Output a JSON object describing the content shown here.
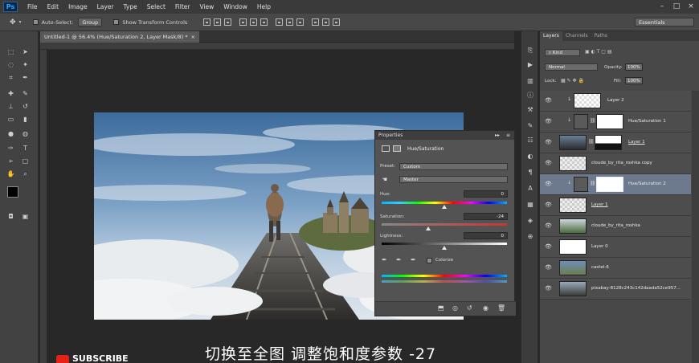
{
  "app": {
    "logo": "Ps"
  },
  "menu": [
    "File",
    "Edit",
    "Image",
    "Layer",
    "Type",
    "Select",
    "Filter",
    "View",
    "Window",
    "Help"
  ],
  "options_bar": {
    "auto_select_label": "Auto-Select:",
    "auto_select_value": "Group",
    "show_transform_label": "Show Transform Controls",
    "workspace": "Essentials"
  },
  "document_tab": {
    "title": "Untitled-1 @ 56.4% (Hue/Saturation 2, Layer Mask/8) *"
  },
  "properties": {
    "title": "Properties",
    "adjustment": "Hue/Saturation",
    "preset_label": "Preset:",
    "preset_value": "Custom",
    "channel_value": "Master",
    "hue_label": "Hue:",
    "hue_value": "0",
    "saturation_label": "Saturation:",
    "saturation_value": "-24",
    "lightness_label": "Lightness:",
    "lightness_value": "0",
    "colorize_label": "Colorize"
  },
  "layers_panel": {
    "tabs": [
      "Layers",
      "Channels",
      "Paths"
    ],
    "kind_label": "Kind",
    "blend_mode": "Normal",
    "opacity_label": "Opacity:",
    "opacity_value": "100%",
    "lock_label": "Lock:",
    "fill_label": "Fill:",
    "fill_value": "100%",
    "layers": [
      {
        "name": "Layer 2"
      },
      {
        "name": "Hue/Saturation 1"
      },
      {
        "name": "Layer 1"
      },
      {
        "name": "cloude_by_rita_roshka copy"
      },
      {
        "name": "Hue/Saturation 2"
      },
      {
        "name": "Layer 1"
      },
      {
        "name": "cloude_by_rita_roshka"
      },
      {
        "name": "Layer 0"
      },
      {
        "name": "castel-6"
      },
      {
        "name": "pixabay-8128c243c142daada52ce957..."
      }
    ]
  },
  "subtitle": "切换至全图 调整饱和度参数 -27",
  "subscribe_text": "SUBSCRIBE"
}
